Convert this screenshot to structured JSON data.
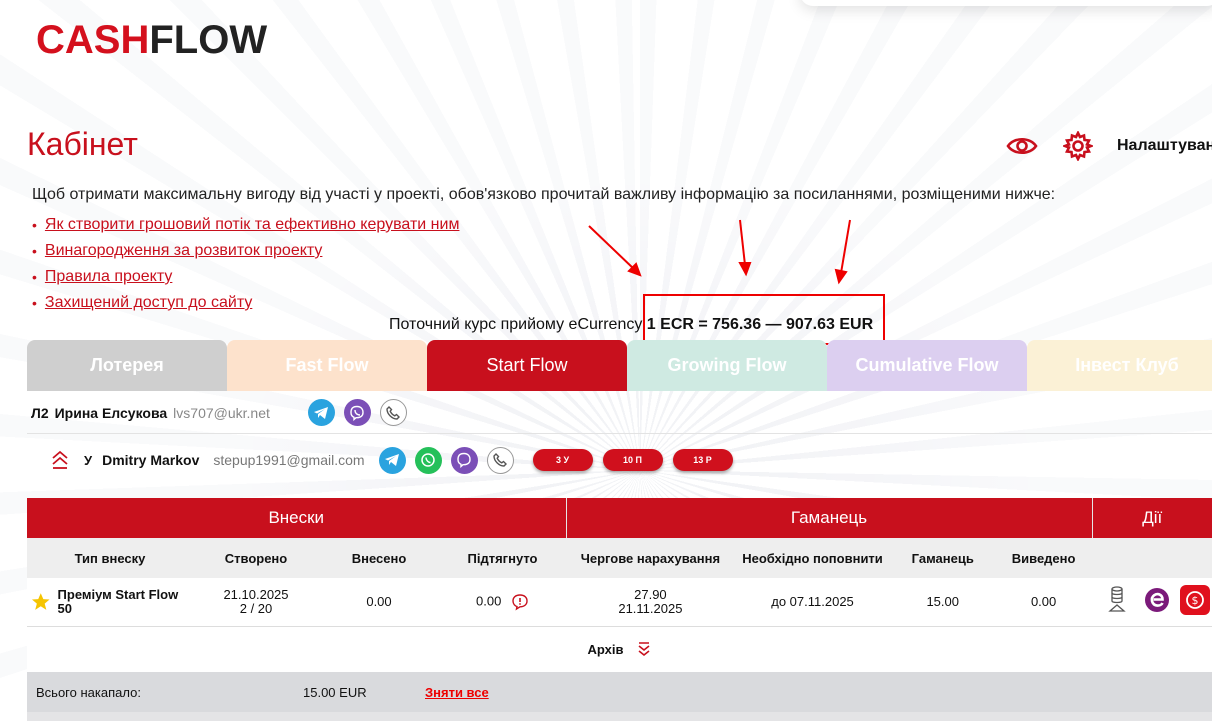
{
  "brand": {
    "part1": "CASH",
    "part2": "FLOW",
    "accent": "#c8101d"
  },
  "header": {
    "page_title": "Кабінет",
    "settings_label": "Налаштування",
    "icons": [
      "eye-icon",
      "gear-icon"
    ]
  },
  "intro": {
    "text": "Щоб отримати максимальну вигоду від участі у проекті, обов'язково прочитай важливу інформацію за посиланнями, розміщеними нижче:",
    "links": [
      "Як створити грошовий потік та ефективно керувати ним",
      "Винагородження за розвиток проекту",
      "Правила проекту",
      "Захищений доступ до сайту"
    ]
  },
  "rate": {
    "label": "Поточний курс прийому eCurrency",
    "value": "1 ECR = 756.36 — 907.63 EUR"
  },
  "tabs": [
    {
      "label": "Лотерея",
      "color": "#cfcfcf"
    },
    {
      "label": "Fast Flow",
      "color": "#fde2cc"
    },
    {
      "label": "Start Flow",
      "color": "#c8101d"
    },
    {
      "label": "Growing Flow",
      "color": "#cfeae2"
    },
    {
      "label": "Cumulative Flow",
      "color": "#dccff0"
    },
    {
      "label": "Інвест Клуб",
      "color": "#fbf1d6"
    }
  ],
  "upline": {
    "level": "Л2",
    "name": "Ирина Елсукова",
    "email": "lvs707@ukr.net"
  },
  "sponsor": {
    "label": "У",
    "name": "Dmitry Markov",
    "email": "stepup1991@gmail.com",
    "pills": [
      "3 У",
      "10 П",
      "13 Р"
    ]
  },
  "table": {
    "groups": [
      "Внески",
      "Гаманець",
      "Дії"
    ],
    "headers": [
      "Тип внеску",
      "Створено",
      "Внесено",
      "Підтягнуто",
      "Чергове нарахування",
      "Необхідно поповнити",
      "Гаманець",
      "Виведено"
    ],
    "row": {
      "type": "Преміум Start Flow 50",
      "created": "21.10.2025",
      "created_sub": "2 / 20",
      "deposited": "0.00",
      "pulled": "0.00",
      "next_accrual": "27.90",
      "next_date": "21.11.2025",
      "topup": "до 07.11.2025",
      "wallet": "15.00",
      "withdrawn": "0.00"
    },
    "archive": "Архів",
    "total_label": "Всього накапало:",
    "total_value": "15.00 EUR",
    "withdraw_all": "Зняти все"
  }
}
